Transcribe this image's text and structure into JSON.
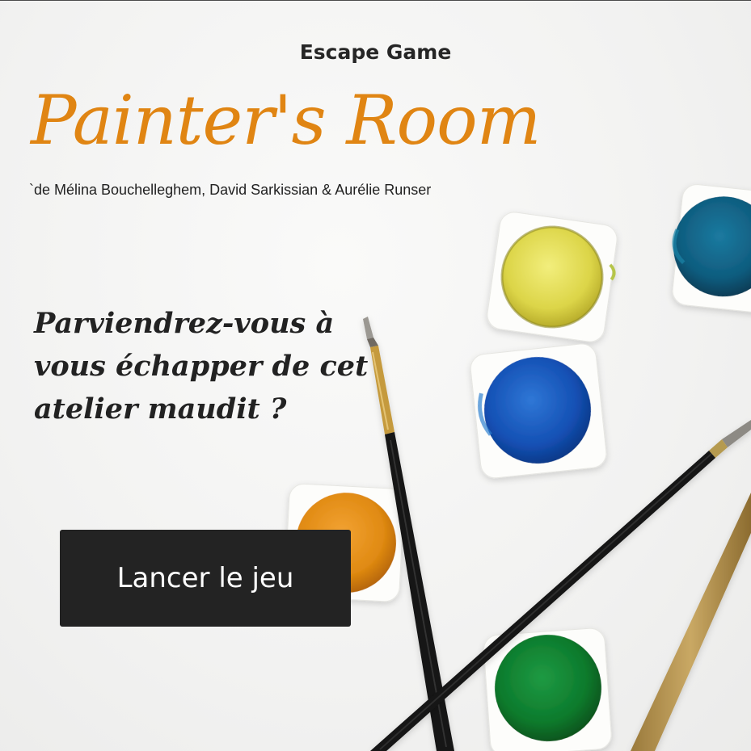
{
  "header": {
    "kicker": "Escape Game",
    "title": "Painter's Room",
    "authors": "`de Mélina Bouchelleghem, David Sarkissian & Aurélie Runser"
  },
  "hero": {
    "tagline": "Parviendrez-vous à vous échapper de cet atelier maudit ?"
  },
  "actions": {
    "start_label": "Lancer le jeu"
  },
  "colors": {
    "accent": "#e08513",
    "button_bg": "#232323",
    "button_text": "#ffffff",
    "text_dark": "#222222",
    "paint_yellow": "#e2dc4e",
    "paint_blue": "#1450b4",
    "paint_teal": "#0f5c7e",
    "paint_orange": "#e08a12",
    "paint_green": "#0c7a2c"
  }
}
